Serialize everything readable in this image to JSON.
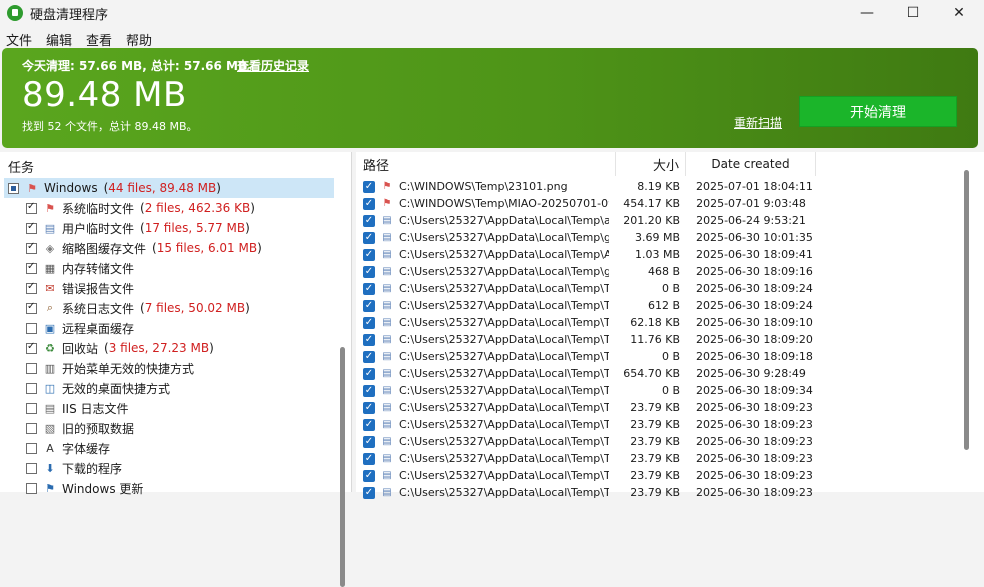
{
  "window": {
    "title": "硬盘清理程序",
    "min": "—",
    "max": "☐",
    "close": "✕"
  },
  "menu": [
    "文件",
    "编辑",
    "查看",
    "帮助"
  ],
  "banner": {
    "summary": "今天清理: 57.66 MB, 总计: 57.66 MB。",
    "history_link": "查看历史记录",
    "total_size": "89.48 MB",
    "found_text": "找到 52 个文件，总计 89.48 MB。",
    "rescan_link": "重新扫描",
    "start_button": "开始清理"
  },
  "left": {
    "header": "任务",
    "root": {
      "label": "Windows",
      "open": "(",
      "count": "44 files, 89.48 MB",
      "close": ")"
    },
    "items": [
      {
        "label": "系统临时文件",
        "count": "2 files, 462.36 KB",
        "checked": true,
        "icon": "windows-flag-icon"
      },
      {
        "label": "用户临时文件",
        "count": "17 files, 5.77 MB",
        "checked": true,
        "icon": "temp-file-icon"
      },
      {
        "label": "缩略图缓存文件",
        "count": "15 files, 6.01 MB",
        "checked": true,
        "icon": "thumbnail-icon"
      },
      {
        "label": "内存转储文件",
        "count": "",
        "checked": true,
        "icon": "memory-dump-icon"
      },
      {
        "label": "错误报告文件",
        "count": "",
        "checked": true,
        "icon": "error-report-icon"
      },
      {
        "label": "系统日志文件",
        "count": "7 files, 50.02 MB",
        "checked": true,
        "icon": "log-search-icon"
      },
      {
        "label": "远程桌面缓存",
        "count": "",
        "checked": false,
        "icon": "remote-desktop-icon"
      },
      {
        "label": "回收站",
        "count": "3 files, 27.23 MB",
        "checked": true,
        "icon": "recycle-bin-icon"
      },
      {
        "label": "开始菜单无效的快捷方式",
        "count": "",
        "checked": false,
        "icon": "start-menu-icon"
      },
      {
        "label": "无效的桌面快捷方式",
        "count": "",
        "checked": false,
        "icon": "desktop-shortcut-icon"
      },
      {
        "label": "IIS 日志文件",
        "count": "",
        "checked": false,
        "icon": "iis-log-icon"
      },
      {
        "label": "旧的预取数据",
        "count": "",
        "checked": false,
        "icon": "prefetch-icon"
      },
      {
        "label": "字体缓存",
        "count": "",
        "checked": false,
        "icon": "font-cache-icon"
      },
      {
        "label": "下载的程序",
        "count": "",
        "checked": false,
        "icon": "download-program-icon"
      },
      {
        "label": "Windows 更新",
        "count": "",
        "checked": false,
        "icon": "windows-update-icon"
      }
    ]
  },
  "right": {
    "columns": {
      "path": "路径",
      "size": "大小",
      "date": "Date created"
    },
    "rows": [
      {
        "path": "C:\\WINDOWS\\Temp\\23101.png",
        "size": "8.19 KB",
        "date": "2025-07-01 18:04:11",
        "icon": "windows-flag-icon"
      },
      {
        "path": "C:\\WINDOWS\\Temp\\MIAO-20250701-09...",
        "size": "454.17 KB",
        "date": "2025-07-01 9:03:48",
        "icon": "windows-flag-icon"
      },
      {
        "path": "C:\\Users\\25327\\AppData\\Local\\Temp\\am...",
        "size": "201.20 KB",
        "date": "2025-06-24 9:53:21",
        "icon": "temp-file-icon"
      },
      {
        "path": "C:\\Users\\25327\\AppData\\Local\\Temp\\ge...",
        "size": "3.69 MB",
        "date": "2025-06-30 10:01:35",
        "icon": "temp-file-icon"
      },
      {
        "path": "C:\\Users\\25327\\AppData\\Local\\Temp\\An...",
        "size": "1.03 MB",
        "date": "2025-06-30 18:09:41",
        "icon": "temp-file-icon"
      },
      {
        "path": "C:\\Users\\25327\\AppData\\Local\\Temp\\gb...",
        "size": "468 B",
        "date": "2025-06-30 18:09:16",
        "icon": "temp-file-icon"
      },
      {
        "path": "C:\\Users\\25327\\AppData\\Local\\Temp\\Te...",
        "size": "0 B",
        "date": "2025-06-30 18:09:24",
        "icon": "temp-file-icon"
      },
      {
        "path": "C:\\Users\\25327\\AppData\\Local\\Temp\\Te...",
        "size": "612 B",
        "date": "2025-06-30 18:09:24",
        "icon": "temp-file-icon"
      },
      {
        "path": "C:\\Users\\25327\\AppData\\Local\\Temp\\Te...",
        "size": "62.18 KB",
        "date": "2025-06-30 18:09:10",
        "icon": "temp-file-icon"
      },
      {
        "path": "C:\\Users\\25327\\AppData\\Local\\Temp\\Te...",
        "size": "11.76 KB",
        "date": "2025-06-30 18:09:20",
        "icon": "temp-file-icon"
      },
      {
        "path": "C:\\Users\\25327\\AppData\\Local\\Temp\\Te...",
        "size": "0 B",
        "date": "2025-06-30 18:09:18",
        "icon": "temp-file-icon"
      },
      {
        "path": "C:\\Users\\25327\\AppData\\Local\\Temp\\Te...",
        "size": "654.70 KB",
        "date": "2025-06-30 9:28:49",
        "icon": "temp-file-icon"
      },
      {
        "path": "C:\\Users\\25327\\AppData\\Local\\Temp\\Te...",
        "size": "0 B",
        "date": "2025-06-30 18:09:34",
        "icon": "temp-file-icon"
      },
      {
        "path": "C:\\Users\\25327\\AppData\\Local\\Temp\\Te...",
        "size": "23.79 KB",
        "date": "2025-06-30 18:09:23",
        "icon": "temp-file-icon"
      },
      {
        "path": "C:\\Users\\25327\\AppData\\Local\\Temp\\Te...",
        "size": "23.79 KB",
        "date": "2025-06-30 18:09:23",
        "icon": "temp-file-icon"
      },
      {
        "path": "C:\\Users\\25327\\AppData\\Local\\Temp\\Te...",
        "size": "23.79 KB",
        "date": "2025-06-30 18:09:23",
        "icon": "temp-file-icon"
      },
      {
        "path": "C:\\Users\\25327\\AppData\\Local\\Temp\\Te...",
        "size": "23.79 KB",
        "date": "2025-06-30 18:09:23",
        "icon": "temp-file-icon"
      },
      {
        "path": "C:\\Users\\25327\\AppData\\Local\\Temp\\Te...",
        "size": "23.79 KB",
        "date": "2025-06-30 18:09:23",
        "icon": "temp-file-icon"
      },
      {
        "path": "C:\\Users\\25327\\AppData\\Local\\Temp\\Te...",
        "size": "23.79 KB",
        "date": "2025-06-30 18:09:23",
        "icon": "temp-file-icon"
      }
    ]
  }
}
